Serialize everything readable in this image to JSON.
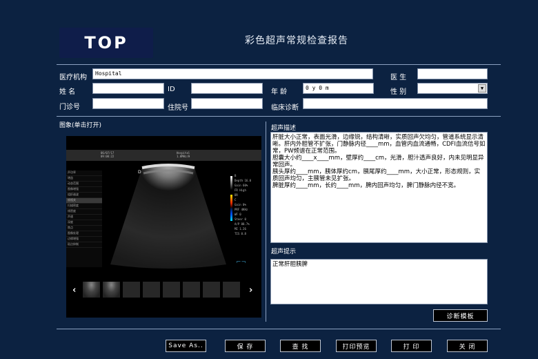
{
  "header": {
    "logo_text": "TOP",
    "title": "彩色超声常规检查报告"
  },
  "form": {
    "institution_label": "医疗机构",
    "institution_value": "Hospital",
    "doctor_label": "医 生",
    "doctor_value": "",
    "name_label": "姓 名",
    "name_value": "",
    "id_label": "ID",
    "id_value": "",
    "age_label": "年 龄",
    "age_value": "0 y 0 m",
    "sex_label": "性 别",
    "sex_value": "",
    "outpatient_label": "门诊号",
    "outpatient_value": "",
    "inpatient_label": "住院号",
    "inpatient_value": "",
    "clinical_label": "临床诊断",
    "clinical_value": ""
  },
  "image_panel": {
    "label": "图象(单击打开)",
    "ultrasound": {
      "top_left": "06/07/17 09:00:22",
      "top_right": "Hospital 1.0MHz/H",
      "params": [
        "声功率",
        "增益",
        "动态范围",
        "图像增强",
        "组织谐波",
        "帧相关",
        "扫描密度",
        "线密度",
        "声速",
        "深度",
        "焦点",
        "图像处理",
        "边缘增强",
        "斑点抑制"
      ],
      "right_text": [
        "B",
        "Depth 16.0",
        "Gain 60%",
        "FR High",
        "DR",
        "C",
        "Gain 0%",
        "PRF 4KHz",
        "WF 0",
        "Steer 0",
        "A/P 88.7%",
        "MI 1.26",
        "TIS 0.8"
      ]
    }
  },
  "description": {
    "label": "超声描述",
    "text": "肝脏大小正常，表面光滑，边缘锐，结构清晰，实质回声欠均匀，管道系统显示清晰。肝内外胆管不扩张，门静脉内径____mm，血管内血流通畅，CDFI血流信号如常，PW频谱在正常范围。\n胆囊大小约____x____mm，壁厚约____cm，光滑，胆汁透声良好，内未见明显异常回声。\n胰头厚约____mm，胰体厚约cm，胰尾厚约____mm，大小正常，形态规则，实质回声均匀，主胰管未见扩张。\n脾脏厚约____mm，长约____mm，脾内回声均匀，脾门静脉内径不宽。"
  },
  "hint": {
    "label": "超声提示",
    "text": "正常肝胆胰脾"
  },
  "buttons": {
    "template": "诊断模板",
    "save_as": "Save As..",
    "save": "保 存",
    "find": "查 找",
    "print_preview": "打印预览",
    "print": "打 印",
    "close": "关 闭"
  }
}
